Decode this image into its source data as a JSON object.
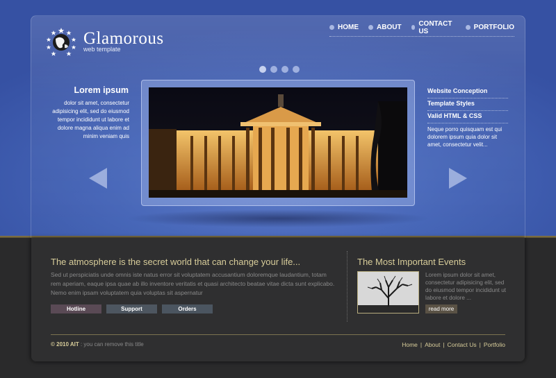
{
  "brand": {
    "name": "Glamorous",
    "tagline": "web template"
  },
  "nav": [
    {
      "label": "HOME"
    },
    {
      "label": "ABOUT"
    },
    {
      "label": "CONTACT US"
    },
    {
      "label": "PORTFOLIO"
    }
  ],
  "slider": {
    "dot_count": 4,
    "active_index": 0
  },
  "intro": {
    "title": "Lorem ipsum",
    "body": "dolor sit amet, consectetur adipisicing elit, sed do eiusmod tempor incididunt ut labore et dolore magna aliqua enim ad minim veniam quis"
  },
  "side_links": [
    {
      "label": "Website Conception"
    },
    {
      "label": "Template Styles"
    },
    {
      "label": "Valid HTML & CSS"
    }
  ],
  "side_text": "Neque porro quisquam est qui dolorem ipsum quia dolor sit amet, consectetur velit...",
  "feature": {
    "title": "The atmosphere is the secret world that can change your life...",
    "body": "Sed ut perspiciatis unde omnis iste natus error sit voluptatem accusantium doloremque laudantium, totam rem aperiam, eaque ipsa quae ab illo inventore veritatis et quasi architecto beatae vitae dicta sunt explicabo. Nemo enim ipsam voluptatem quia voluptas sit aspernatur",
    "buttons": [
      {
        "label": "Hotline"
      },
      {
        "label": "Support"
      },
      {
        "label": "Orders"
      }
    ]
  },
  "events": {
    "title": "The Most Important Events",
    "body": "Lorem ipsum dolor sit amet, consectetur adipisicing elit, sed do eiusmod tempor incididunt ut labore et dolore ...",
    "read_more": "read more"
  },
  "footer": {
    "copyright_strong": "© 2010 AIT",
    "copyright_rest": " : you can remove this title",
    "links": [
      {
        "label": "Home"
      },
      {
        "label": "About"
      },
      {
        "label": "Contact Us"
      },
      {
        "label": "Portfolio"
      }
    ],
    "separator": "|"
  },
  "colors": {
    "accent_gold": "#d8cd9a",
    "top_blue": "#4565b8",
    "bottom_dark": "#2a2a2b"
  }
}
